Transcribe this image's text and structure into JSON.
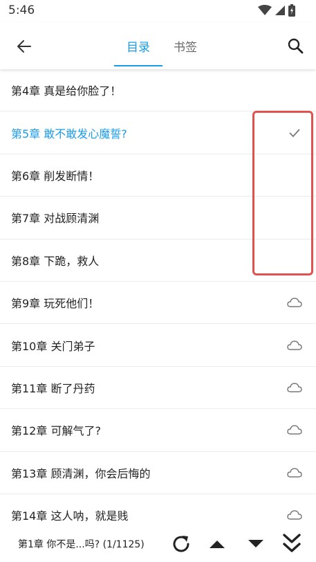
{
  "status_bar": {
    "time": "5:46",
    "icons": [
      "wifi-icon",
      "signal-icon",
      "battery-icon"
    ]
  },
  "app_bar": {
    "back_icon": "arrow-left-icon",
    "tabs": [
      {
        "label": "目录",
        "active": true
      },
      {
        "label": "书签",
        "active": false
      }
    ],
    "search_icon": "search-icon"
  },
  "chapters": [
    {
      "title": "第4章 真是给你脸了！",
      "icon": "",
      "current": false
    },
    {
      "title": "第5章 敢不敢发心魔誓?",
      "icon": "check-icon",
      "current": true
    },
    {
      "title": "第6章 削发断情！",
      "icon": "",
      "current": false
    },
    {
      "title": "第7章 对战顾清渊",
      "icon": "",
      "current": false
    },
    {
      "title": "第8章 下跪，救人",
      "icon": "",
      "current": false
    },
    {
      "title": "第9章 玩死他们！",
      "icon": "cloud-icon",
      "current": false
    },
    {
      "title": "第10章 关门弟子",
      "icon": "cloud-icon",
      "current": false
    },
    {
      "title": "第11章 断了丹药",
      "icon": "cloud-icon",
      "current": false
    },
    {
      "title": "第12章 可解气了?",
      "icon": "cloud-icon",
      "current": false
    },
    {
      "title": "第13章 顾清渊，你会后悔的",
      "icon": "cloud-icon",
      "current": false
    },
    {
      "title": "第14章 这人呐，就是贱",
      "icon": "cloud-icon",
      "current": false
    }
  ],
  "bottom_bar": {
    "current_label": "第1章 你不是...吗? (1/1125)",
    "buttons": [
      "refresh-icon",
      "scroll-up-icon",
      "scroll-down-icon",
      "scroll-to-bottom-icon"
    ]
  },
  "colors": {
    "accent": "#1a9be8",
    "highlight_border": "#e35050",
    "icon_gray": "#777777"
  }
}
